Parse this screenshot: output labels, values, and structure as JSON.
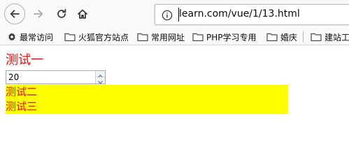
{
  "toolbar": {
    "url": "learn.com/vue/1/13.html"
  },
  "bookmarks": [
    {
      "label": "最常访问",
      "icon": "gear-icon"
    },
    {
      "label": "火狐官方站点",
      "icon": "folder-icon"
    },
    {
      "label": "常用网址",
      "icon": "folder-icon"
    },
    {
      "label": "PHP学习专用",
      "icon": "folder-icon"
    },
    {
      "label": "婚庆",
      "icon": "folder-icon"
    },
    {
      "label": "建站工",
      "icon": "folder-icon"
    }
  ],
  "content": {
    "heading": "测试一",
    "number_value": "20",
    "line2": "测试二",
    "line3": "测试三"
  },
  "colors": {
    "text_red": "#e01010",
    "highlight_yellow": "#ffff00"
  }
}
